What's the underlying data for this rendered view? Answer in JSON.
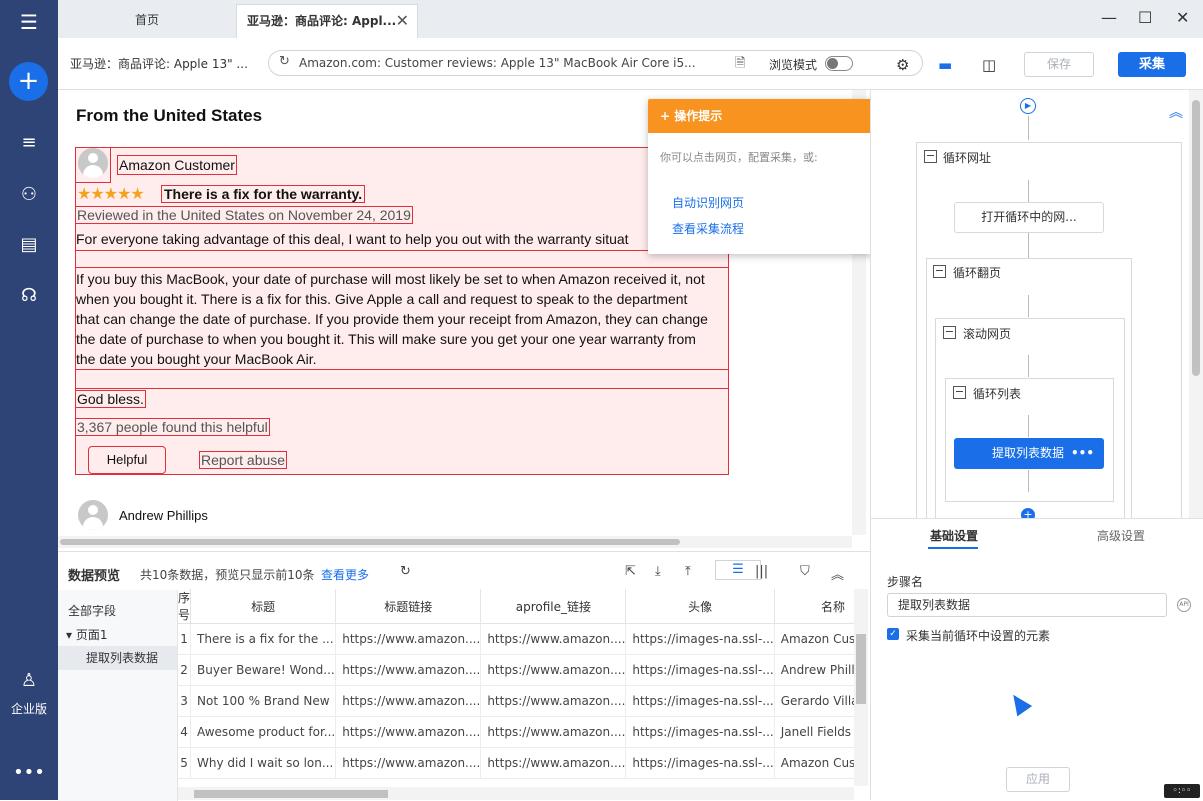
{
  "tabs": {
    "home": "首页",
    "active": "亚马逊：商品评论: Appl..."
  },
  "address": {
    "page_title": "亚马逊：商品评论: Apple 13\" ...",
    "url": "Amazon.com: Customer reviews: Apple 13\" MacBook Air Core i5...",
    "browse_mode": "浏览模式",
    "save": "保存",
    "collect": "采集"
  },
  "sidebar": {
    "enterprise": "企业版"
  },
  "page": {
    "section_title": "From the United States",
    "review": {
      "author": "Amazon Customer",
      "stars": "★★★★★",
      "rating": 5,
      "title": "There is a fix for the warranty.",
      "date": "Reviewed in the United States on November 24, 2019",
      "lines": [
        "For everyone taking advantage of this deal, I want to help you out with the warranty situat",
        "If you buy this MacBook, your date of purchase will most likely be set to when Amazon received it, not",
        "when you bought it. There is a fix for this. Give Apple a call and request to speak to the department",
        "that can change the date of purchase. If you provide them your receipt from Amazon, they can change",
        "the date of purchase to when you bought it. This will make sure you get your one year warranty from",
        "the date you bought your MacBook Air."
      ],
      "bless": "God bless.",
      "helpful_count": "3,367 people found this helpful",
      "helpful_btn": "Helpful",
      "report": "Report abuse"
    },
    "next_author": "Andrew Phillips"
  },
  "tips": {
    "title": "操作提示",
    "desc": "你可以点击网页，配置采集，或:",
    "auto": "自动识别网页",
    "view": "查看采集流程"
  },
  "flow": {
    "loop_url": "循环网址",
    "open_loop": "打开循环中的网...",
    "loop_page": "循环翻页",
    "scroll": "滚动网页",
    "loop_list": "循环列表",
    "extract": "提取列表数据"
  },
  "settings": {
    "tab_basic": "基础设置",
    "tab_advanced": "高级设置",
    "step_label": "步骤名",
    "step_value": "提取列表数据",
    "checkbox": "采集当前循环中设置的元素",
    "apply": "应用"
  },
  "preview": {
    "title": "数据预览",
    "info": "共10条数据，预览只显示前10条",
    "more": "查看更多",
    "tree": {
      "all": "全部字段",
      "page": "页面1",
      "extract": "提取列表数据"
    },
    "columns": [
      "序号",
      "标题",
      "标题链接",
      "aprofile_链接",
      "头像",
      "名称"
    ],
    "rows": [
      [
        "1",
        "There is a fix for the ...",
        "https://www.amazon....",
        "https://www.amazon....",
        "https://images-na.ssl-...",
        "Amazon Customer"
      ],
      [
        "2",
        "Buyer Beware! Wond...",
        "https://www.amazon....",
        "https://www.amazon....",
        "https://images-na.ssl-...",
        "Andrew Phillips"
      ],
      [
        "3",
        "Not 100 % Brand New",
        "https://www.amazon....",
        "https://www.amazon....",
        "https://images-na.ssl-...",
        "Gerardo Villalobos"
      ],
      [
        "4",
        "Awesome product for...",
        "https://www.amazon....",
        "https://www.amazon....",
        "https://images-na.ssl-...",
        "Janell Fields"
      ],
      [
        "5",
        "Why did I wait so lon...",
        "https://www.amazon....",
        "https://www.amazon....",
        "https://images-na.ssl-...",
        "Amazon Customer"
      ]
    ]
  },
  "colors": {
    "accent": "#1a6fe8",
    "sidebar": "#2f4476",
    "tips": "#f7931e",
    "highlight": "#e0303a"
  },
  "icons": [
    "menu-icon",
    "plus-icon",
    "list-icon",
    "users-icon",
    "task-icon",
    "headset-icon",
    "user-icon",
    "more-icon",
    "refresh-icon",
    "settings-icon",
    "play-icon"
  ]
}
